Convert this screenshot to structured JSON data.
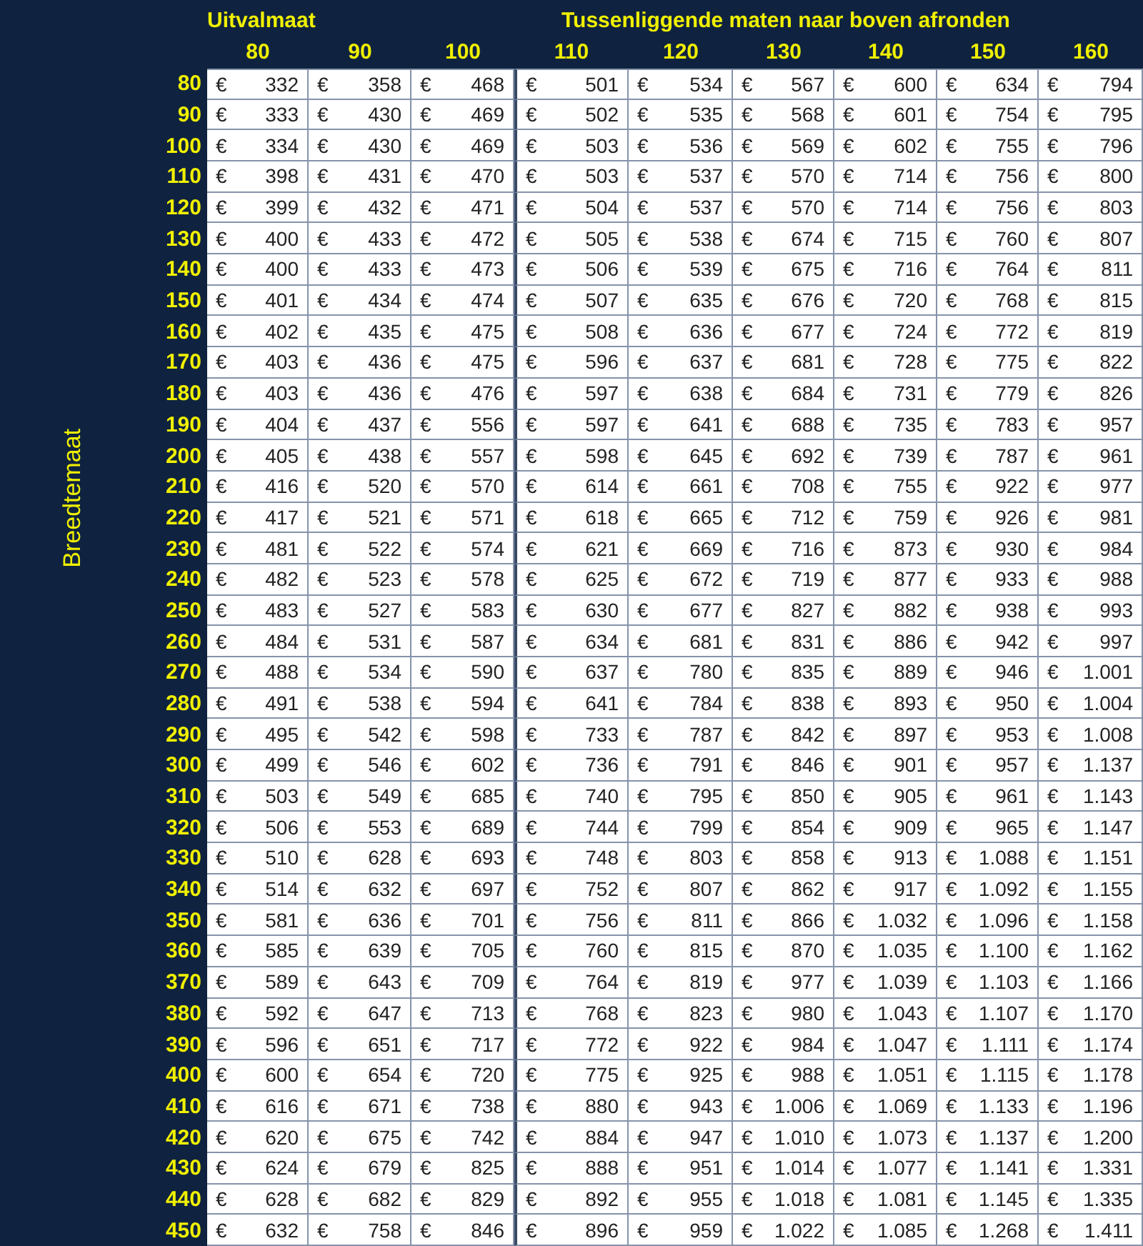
{
  "axis_label": "Breedtemaat",
  "group_headers": [
    "Uitvalmaat",
    "Tussenliggende maten naar boven afronden"
  ],
  "columns": [
    "80",
    "90",
    "100",
    "110",
    "120",
    "130",
    "140",
    "150",
    "160"
  ],
  "rows": [
    {
      "label": "80",
      "cells": [
        "€ 332",
        "€ 358",
        "€ 468",
        "€ 501",
        "€ 534",
        "€ 567",
        "€ 600",
        "€ 634",
        "€ 794"
      ]
    },
    {
      "label": "90",
      "cells": [
        "€ 333",
        "€ 430",
        "€ 469",
        "€ 502",
        "€ 535",
        "€ 568",
        "€ 601",
        "€ 754",
        "€ 795"
      ]
    },
    {
      "label": "100",
      "cells": [
        "€ 334",
        "€ 430",
        "€ 469",
        "€ 503",
        "€ 536",
        "€ 569",
        "€ 602",
        "€ 755",
        "€ 796"
      ]
    },
    {
      "label": "110",
      "cells": [
        "€ 398",
        "€ 431",
        "€ 470",
        "€ 503",
        "€ 537",
        "€ 570",
        "€ 714",
        "€ 756",
        "€ 800"
      ]
    },
    {
      "label": "120",
      "cells": [
        "€ 399",
        "€ 432",
        "€ 471",
        "€ 504",
        "€ 537",
        "€ 570",
        "€ 714",
        "€ 756",
        "€ 803"
      ]
    },
    {
      "label": "130",
      "cells": [
        "€ 400",
        "€ 433",
        "€ 472",
        "€ 505",
        "€ 538",
        "€ 674",
        "€ 715",
        "€ 760",
        "€ 807"
      ]
    },
    {
      "label": "140",
      "cells": [
        "€ 400",
        "€ 433",
        "€ 473",
        "€ 506",
        "€ 539",
        "€ 675",
        "€ 716",
        "€ 764",
        "€ 811"
      ]
    },
    {
      "label": "150",
      "cells": [
        "€ 401",
        "€ 434",
        "€ 474",
        "€ 507",
        "€ 635",
        "€ 676",
        "€ 720",
        "€ 768",
        "€ 815"
      ]
    },
    {
      "label": "160",
      "cells": [
        "€ 402",
        "€ 435",
        "€ 475",
        "€ 508",
        "€ 636",
        "€ 677",
        "€ 724",
        "€ 772",
        "€ 819"
      ]
    },
    {
      "label": "170",
      "cells": [
        "€ 403",
        "€ 436",
        "€ 475",
        "€ 596",
        "€ 637",
        "€ 681",
        "€ 728",
        "€ 775",
        "€ 822"
      ]
    },
    {
      "label": "180",
      "cells": [
        "€ 403",
        "€ 436",
        "€ 476",
        "€ 597",
        "€ 638",
        "€ 684",
        "€ 731",
        "€ 779",
        "€ 826"
      ]
    },
    {
      "label": "190",
      "cells": [
        "€ 404",
        "€ 437",
        "€ 556",
        "€ 597",
        "€ 641",
        "€ 688",
        "€ 735",
        "€ 783",
        "€ 957"
      ]
    },
    {
      "label": "200",
      "cells": [
        "€ 405",
        "€ 438",
        "€ 557",
        "€ 598",
        "€ 645",
        "€ 692",
        "€ 739",
        "€ 787",
        "€ 961"
      ]
    },
    {
      "label": "210",
      "cells": [
        "€ 416",
        "€ 520",
        "€ 570",
        "€ 614",
        "€ 661",
        "€ 708",
        "€ 755",
        "€ 922",
        "€ 977"
      ]
    },
    {
      "label": "220",
      "cells": [
        "€ 417",
        "€ 521",
        "€ 571",
        "€ 618",
        "€ 665",
        "€ 712",
        "€ 759",
        "€ 926",
        "€ 981"
      ]
    },
    {
      "label": "230",
      "cells": [
        "€ 481",
        "€ 522",
        "€ 574",
        "€ 621",
        "€ 669",
        "€ 716",
        "€ 873",
        "€ 930",
        "€ 984"
      ]
    },
    {
      "label": "240",
      "cells": [
        "€ 482",
        "€ 523",
        "€ 578",
        "€ 625",
        "€ 672",
        "€ 719",
        "€ 877",
        "€ 933",
        "€ 988"
      ]
    },
    {
      "label": "250",
      "cells": [
        "€ 483",
        "€ 527",
        "€ 583",
        "€ 630",
        "€ 677",
        "€ 827",
        "€ 882",
        "€ 938",
        "€ 993"
      ]
    },
    {
      "label": "260",
      "cells": [
        "€ 484",
        "€ 531",
        "€ 587",
        "€ 634",
        "€ 681",
        "€ 831",
        "€ 886",
        "€ 942",
        "€ 997"
      ]
    },
    {
      "label": "270",
      "cells": [
        "€ 488",
        "€ 534",
        "€ 590",
        "€ 637",
        "€ 780",
        "€ 835",
        "€ 889",
        "€ 946",
        "€ 1.001"
      ]
    },
    {
      "label": "280",
      "cells": [
        "€ 491",
        "€ 538",
        "€ 594",
        "€ 641",
        "€ 784",
        "€ 838",
        "€ 893",
        "€ 950",
        "€ 1.004"
      ]
    },
    {
      "label": "290",
      "cells": [
        "€ 495",
        "€ 542",
        "€ 598",
        "€ 733",
        "€ 787",
        "€ 842",
        "€ 897",
        "€ 953",
        "€ 1.008"
      ]
    },
    {
      "label": "300",
      "cells": [
        "€ 499",
        "€ 546",
        "€ 602",
        "€ 736",
        "€ 791",
        "€ 846",
        "€ 901",
        "€ 957",
        "€ 1.137"
      ]
    },
    {
      "label": "310",
      "cells": [
        "€ 503",
        "€ 549",
        "€ 685",
        "€ 740",
        "€ 795",
        "€ 850",
        "€ 905",
        "€ 961",
        "€ 1.143"
      ]
    },
    {
      "label": "320",
      "cells": [
        "€ 506",
        "€ 553",
        "€ 689",
        "€ 744",
        "€ 799",
        "€ 854",
        "€ 909",
        "€ 965",
        "€ 1.147"
      ]
    },
    {
      "label": "330",
      "cells": [
        "€ 510",
        "€ 628",
        "€ 693",
        "€ 748",
        "€ 803",
        "€ 858",
        "€ 913",
        "€ 1.088",
        "€ 1.151"
      ]
    },
    {
      "label": "340",
      "cells": [
        "€ 514",
        "€ 632",
        "€ 697",
        "€ 752",
        "€ 807",
        "€ 862",
        "€ 917",
        "€ 1.092",
        "€ 1.155"
      ]
    },
    {
      "label": "350",
      "cells": [
        "€ 581",
        "€ 636",
        "€ 701",
        "€ 756",
        "€ 811",
        "€ 866",
        "€ 1.032",
        "€ 1.096",
        "€ 1.158"
      ]
    },
    {
      "label": "360",
      "cells": [
        "€ 585",
        "€ 639",
        "€ 705",
        "€ 760",
        "€ 815",
        "€ 870",
        "€ 1.035",
        "€ 1.100",
        "€ 1.162"
      ]
    },
    {
      "label": "370",
      "cells": [
        "€ 589",
        "€ 643",
        "€ 709",
        "€ 764",
        "€ 819",
        "€ 977",
        "€ 1.039",
        "€ 1.103",
        "€ 1.166"
      ]
    },
    {
      "label": "380",
      "cells": [
        "€ 592",
        "€ 647",
        "€ 713",
        "€ 768",
        "€ 823",
        "€ 980",
        "€ 1.043",
        "€ 1.107",
        "€ 1.170"
      ]
    },
    {
      "label": "390",
      "cells": [
        "€ 596",
        "€ 651",
        "€ 717",
        "€ 772",
        "€ 922",
        "€ 984",
        "€ 1.047",
        "€ 1.111",
        "€ 1.174"
      ]
    },
    {
      "label": "400",
      "cells": [
        "€ 600",
        "€ 654",
        "€ 720",
        "€ 775",
        "€ 925",
        "€ 988",
        "€ 1.051",
        "€ 1.115",
        "€ 1.178"
      ]
    },
    {
      "label": "410",
      "cells": [
        "€ 616",
        "€ 671",
        "€ 738",
        "€ 880",
        "€ 943",
        "€ 1.006",
        "€ 1.069",
        "€ 1.133",
        "€ 1.196"
      ]
    },
    {
      "label": "420",
      "cells": [
        "€ 620",
        "€ 675",
        "€ 742",
        "€ 884",
        "€ 947",
        "€ 1.010",
        "€ 1.073",
        "€ 1.137",
        "€ 1.200"
      ]
    },
    {
      "label": "430",
      "cells": [
        "€ 624",
        "€ 679",
        "€ 825",
        "€ 888",
        "€ 951",
        "€ 1.014",
        "€ 1.077",
        "€ 1.141",
        "€ 1.331"
      ]
    },
    {
      "label": "440",
      "cells": [
        "€ 628",
        "€ 682",
        "€ 829",
        "€ 892",
        "€ 955",
        "€ 1.018",
        "€ 1.081",
        "€ 1.145",
        "€ 1.335"
      ]
    },
    {
      "label": "450",
      "cells": [
        "€ 632",
        "€ 758",
        "€ 846",
        "€ 896",
        "€ 959",
        "€ 1.022",
        "€ 1.085",
        "€ 1.268",
        "€ 1.411"
      ]
    }
  ]
}
